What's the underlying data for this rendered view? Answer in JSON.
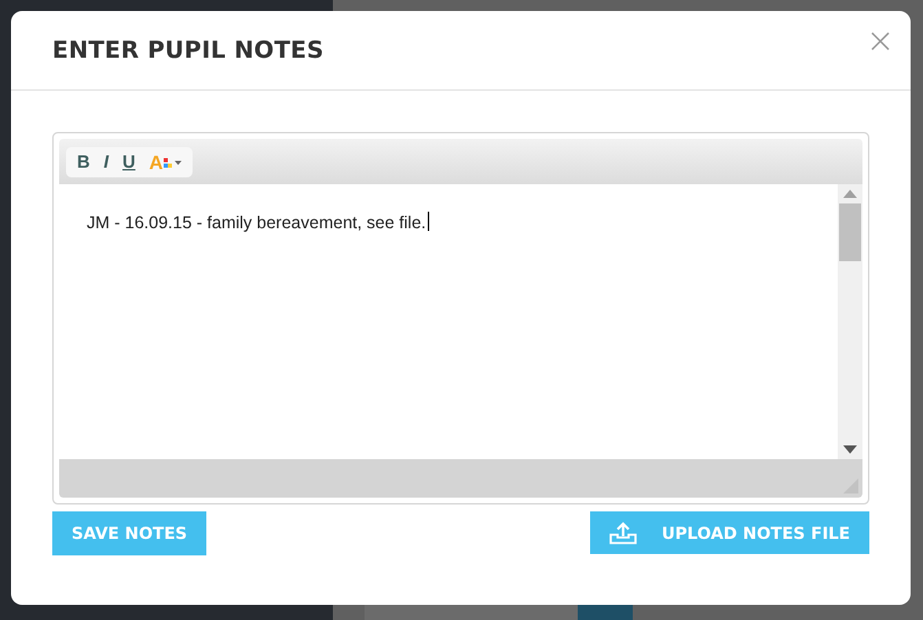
{
  "dialog": {
    "title": "ENTER PUPIL NOTES",
    "toolbar": [
      {
        "kind": "bold",
        "label": "B"
      },
      {
        "kind": "italic",
        "label": "I"
      },
      {
        "kind": "underline",
        "label": "U"
      },
      {
        "kind": "color",
        "label": "A"
      }
    ],
    "content": "JM - 16.09.15 - family bereavement, see file.",
    "buttons": [
      {
        "kind": "save",
        "label": "SAVE NOTES"
      },
      {
        "kind": "upload",
        "label": "UPLOAD NOTES FILE"
      }
    ]
  }
}
